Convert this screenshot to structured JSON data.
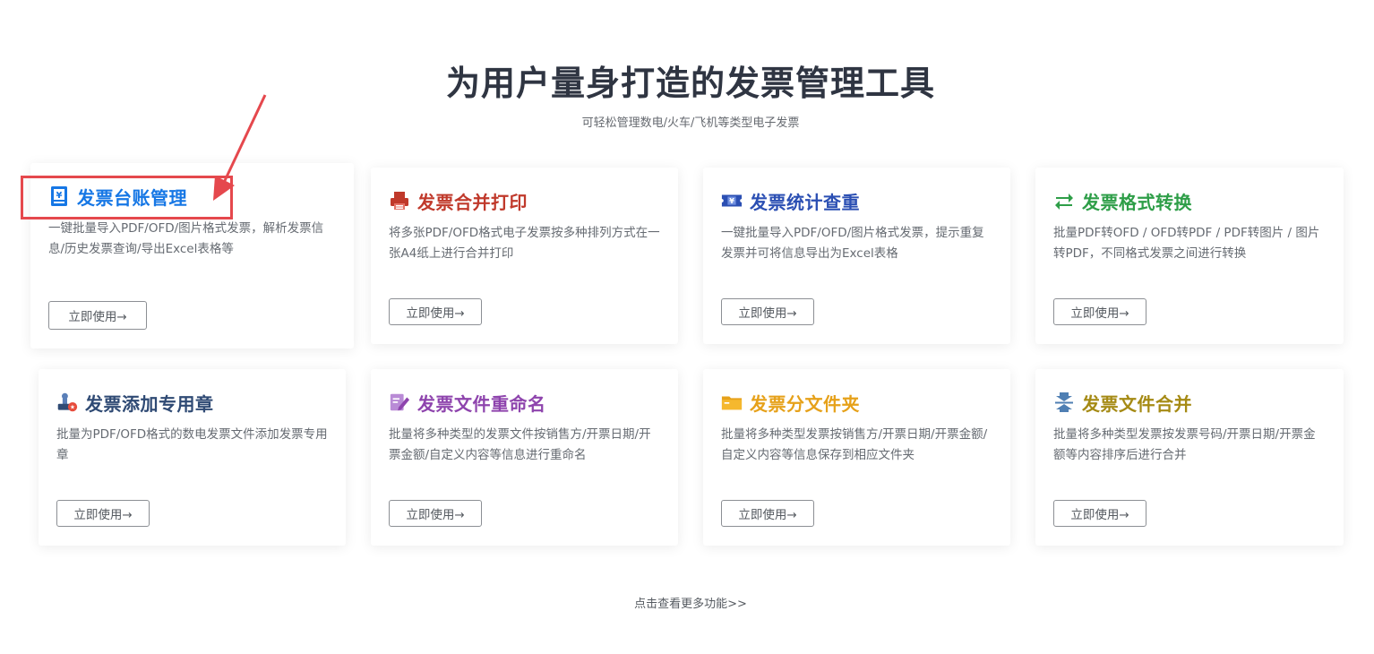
{
  "header": {
    "title": "为用户量身打造的发票管理工具",
    "subtitle": "可轻松管理数电/火车/飞机等类型电子发票"
  },
  "colors": {
    "ledger": "#1677e5",
    "print": "#c0392b",
    "stats": "#2b4fb3",
    "convert": "#2e9e48",
    "stamp": "#2f4a74",
    "rename": "#8e44ad",
    "folder": "#e6a11a",
    "merge": "#a58a14",
    "annotation": "#e5484d"
  },
  "cards": [
    {
      "title": "发票台账管理",
      "icon": "ledger-icon",
      "desc": "一键批量导入PDF/OFD/图片格式发票，解析发票信息/历史发票查询/导出Excel表格等",
      "button": "立即使用→"
    },
    {
      "title": "发票合并打印",
      "icon": "printer-icon",
      "desc": "将多张PDF/OFD格式电子发票按多种排列方式在一张A4纸上进行合并打印",
      "button": "立即使用→"
    },
    {
      "title": "发票统计查重",
      "icon": "yen-ticket-icon",
      "desc": "一键批量导入PDF/OFD/图片格式发票，提示重复发票并可将信息导出为Excel表格",
      "button": "立即使用→"
    },
    {
      "title": "发票格式转换",
      "icon": "swap-arrows-icon",
      "desc": "批量PDF转OFD / OFD转PDF / PDF转图片 / 图片转PDF，不同格式发票之间进行转换",
      "button": "立即使用→"
    },
    {
      "title": "发票添加专用章",
      "icon": "stamp-icon",
      "desc": "批量为PDF/OFD格式的数电发票文件添加发票专用章",
      "button": "立即使用→"
    },
    {
      "title": "发票文件重命名",
      "icon": "edit-document-icon",
      "desc": "批量将多种类型的发票文件按销售方/开票日期/开票金额/自定义内容等信息进行重命名",
      "button": "立即使用→"
    },
    {
      "title": "发票分文件夹",
      "icon": "folder-icon",
      "desc": "批量将多种类型发票按销售方/开票日期/开票金额/自定义内容等信息保存到相应文件夹",
      "button": "立即使用→"
    },
    {
      "title": "发票文件合并",
      "icon": "merge-icon",
      "desc": "批量将多种类型发票按发票号码/开票日期/开票金额等内容排序后进行合并",
      "button": "立即使用→"
    }
  ],
  "footer": {
    "more_link": "点击查看更多功能>>"
  }
}
